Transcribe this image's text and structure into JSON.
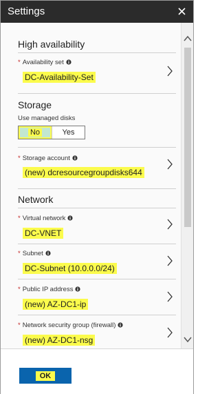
{
  "blade": {
    "title": "Settings"
  },
  "high_availability": {
    "heading": "High availability",
    "availability_set": {
      "label": "Availability set",
      "value": "DC-Availability-Set"
    }
  },
  "storage": {
    "heading": "Storage",
    "managed_disks": {
      "label": "Use managed disks",
      "options": [
        "No",
        "Yes"
      ],
      "selected": "No"
    },
    "storage_account": {
      "label": "Storage account",
      "value": "(new) dcresourcegroupdisks644"
    }
  },
  "network": {
    "heading": "Network",
    "virtual_network": {
      "label": "Virtual network",
      "value": "DC-VNET"
    },
    "subnet": {
      "label": "Subnet",
      "value": "DC-Subnet (10.0.0.0/24)"
    },
    "public_ip": {
      "label": "Public IP address",
      "value": "(new) AZ-DC1-ip"
    },
    "nsg": {
      "label": "Network security group (firewall)",
      "value": "(new) AZ-DC1-nsg"
    }
  },
  "footer": {
    "ok_label": "OK"
  },
  "icons": {
    "close": "close-icon",
    "chevron": "chevron-right-icon",
    "info": "info-icon"
  },
  "colors": {
    "titlebar": "#2b2b2b",
    "highlight": "#fbfb4c",
    "ok_button": "#0a64ad",
    "selected_toggle": "#c2e7d0",
    "required": "#c42b2b"
  }
}
